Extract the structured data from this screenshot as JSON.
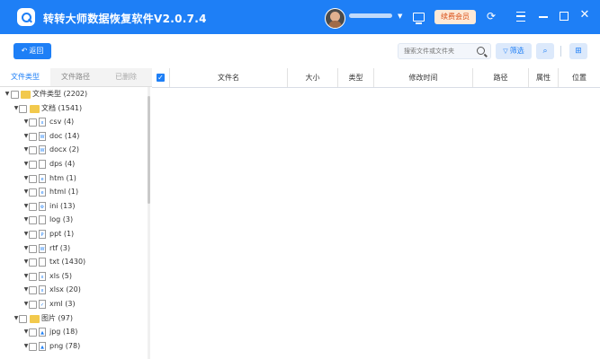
{
  "app": {
    "title": "转转大师数据恢复软件V2.0.7.4",
    "vip_label": "续费会员",
    "colors": {
      "brand": "#1e7ff6",
      "folder": "#f2c94c",
      "vip_text": "#d94f17"
    },
    "icons": [
      "app-logo",
      "avatar",
      "chevron-down-icon",
      "monitor-icon",
      "refresh-icon",
      "menu-icon",
      "minimize-icon",
      "maximize-icon",
      "close-icon"
    ]
  },
  "toolbar": {
    "back_label": "返回",
    "search_placeholder": "搜索文件或文件夹",
    "filter_label": "筛选",
    "preview_icon": "preview-search-icon",
    "grid_icon": "grid-icon"
  },
  "tabs": [
    {
      "label": "文件类型",
      "active": true
    },
    {
      "label": "文件路径",
      "active": false
    },
    {
      "label": "已删除",
      "active": false
    }
  ],
  "tree": [
    {
      "level": 0,
      "label": "文件类型 (2202)",
      "icon": "folder-icon"
    },
    {
      "level": 1,
      "label": "文档 (1541)",
      "icon": "folder-icon"
    },
    {
      "level": 2,
      "label": "csv (4)",
      "icon": "csv-file-icon"
    },
    {
      "level": 2,
      "label": "doc (14)",
      "icon": "doc-file-icon"
    },
    {
      "level": 2,
      "label": "docx (2)",
      "icon": "docx-file-icon"
    },
    {
      "level": 2,
      "label": "dps (4)",
      "icon": "dps-file-icon"
    },
    {
      "level": 2,
      "label": "htm (1)",
      "icon": "htm-file-icon"
    },
    {
      "level": 2,
      "label": "html (1)",
      "icon": "html-file-icon"
    },
    {
      "level": 2,
      "label": "ini (13)",
      "icon": "ini-file-icon"
    },
    {
      "level": 2,
      "label": "log (3)",
      "icon": "log-file-icon"
    },
    {
      "level": 2,
      "label": "ppt (1)",
      "icon": "ppt-file-icon"
    },
    {
      "level": 2,
      "label": "rtf (3)",
      "icon": "rtf-file-icon"
    },
    {
      "level": 2,
      "label": "txt (1430)",
      "icon": "txt-file-icon"
    },
    {
      "level": 2,
      "label": "xls (5)",
      "icon": "xls-file-icon"
    },
    {
      "level": 2,
      "label": "xlsx (20)",
      "icon": "xlsx-file-icon"
    },
    {
      "level": 2,
      "label": "xml (3)",
      "icon": "xml-file-icon"
    },
    {
      "level": 1,
      "label": "图片 (97)",
      "icon": "folder-icon"
    },
    {
      "level": 2,
      "label": "jpg (18)",
      "icon": "jpg-file-icon"
    },
    {
      "level": 2,
      "label": "png (78)",
      "icon": "png-file-icon"
    }
  ],
  "table": {
    "columns": [
      "文件名",
      "大小",
      "类型",
      "修改时间",
      "路径",
      "属性",
      "位置"
    ]
  }
}
